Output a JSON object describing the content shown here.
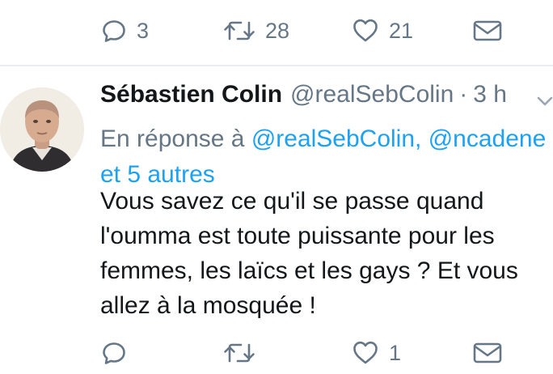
{
  "previous_tweet": {
    "actions": {
      "reply_count": "3",
      "retweet_count": "28",
      "like_count": "21"
    }
  },
  "tweet": {
    "author_name": "Sébastien Colin",
    "author_handle": "@realSebColin",
    "separator": "·",
    "time": "3 h",
    "reply_prefix": "En réponse à",
    "reply_mentions": "@realSebColin, @ncadene",
    "reply_others": "et 5 autres",
    "text": "Vous savez ce qu'il se passe quand l'oumma est toute puissante pour les femmes, les laïcs et les gays ? Et vous allez à la mosquée !",
    "actions": {
      "like_count": "1"
    }
  },
  "colors": {
    "link": "#1da1f2",
    "muted": "#657786",
    "text": "#14171a",
    "divider": "#e6ecf0"
  },
  "icons": [
    "reply-icon",
    "retweet-icon",
    "like-icon",
    "direct-message-icon",
    "chevron-down-icon"
  ]
}
